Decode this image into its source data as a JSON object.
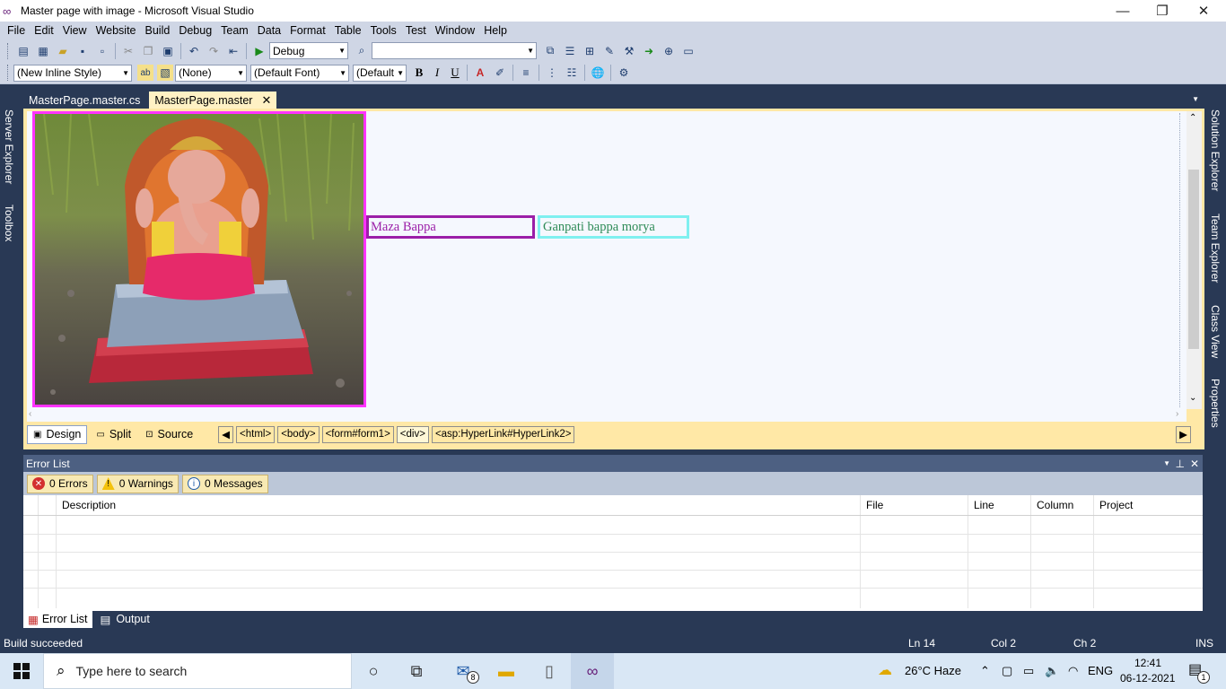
{
  "window": {
    "title": "Master page with image - Microsoft Visual Studio"
  },
  "menu": [
    "File",
    "Edit",
    "View",
    "Website",
    "Build",
    "Debug",
    "Team",
    "Data",
    "Format",
    "Table",
    "Tools",
    "Test",
    "Window",
    "Help"
  ],
  "toolbar": {
    "config": "Debug",
    "platform": ""
  },
  "format_toolbar": {
    "style": "(New Inline Style)",
    "block": "(None)",
    "font": "(Default Font)",
    "size": "(Default",
    "bold": "B",
    "italic": "I",
    "underline": "U"
  },
  "left_tabs": [
    "Server Explorer",
    "Toolbox"
  ],
  "right_tabs": [
    "Solution Explorer",
    "Team Explorer",
    "Class View",
    "Properties"
  ],
  "doc_tabs": [
    {
      "label": "MasterPage.master.cs"
    },
    {
      "label": "MasterPage.master",
      "close": "✕"
    }
  ],
  "design": {
    "hyperlink1": "Maza Bappa",
    "hyperlink2": "Ganpati bappa morya"
  },
  "view_buttons": [
    "Design",
    "Split",
    "Source"
  ],
  "breadcrumbs": [
    "<html>",
    "<body>",
    "<form#form1>",
    "<div>",
    "<asp:HyperLink#HyperLink2>"
  ],
  "error_list": {
    "title": "Error List",
    "errors": "0 Errors",
    "warnings": "0 Warnings",
    "messages": "0 Messages",
    "columns": [
      "Description",
      "File",
      "Line",
      "Column",
      "Project"
    ]
  },
  "bottom_tabs": [
    "Error List",
    "Output"
  ],
  "status": {
    "message": "Build succeeded",
    "line": "Ln 14",
    "col": "Col 2",
    "ch": "Ch 2",
    "mode": "INS"
  },
  "taskbar": {
    "search_placeholder": "Type here to search",
    "mail_badge": "8",
    "weather": "26°C  Haze",
    "lang": "ENG",
    "time": "12:41",
    "date": "06-12-2021",
    "notif": "1"
  }
}
